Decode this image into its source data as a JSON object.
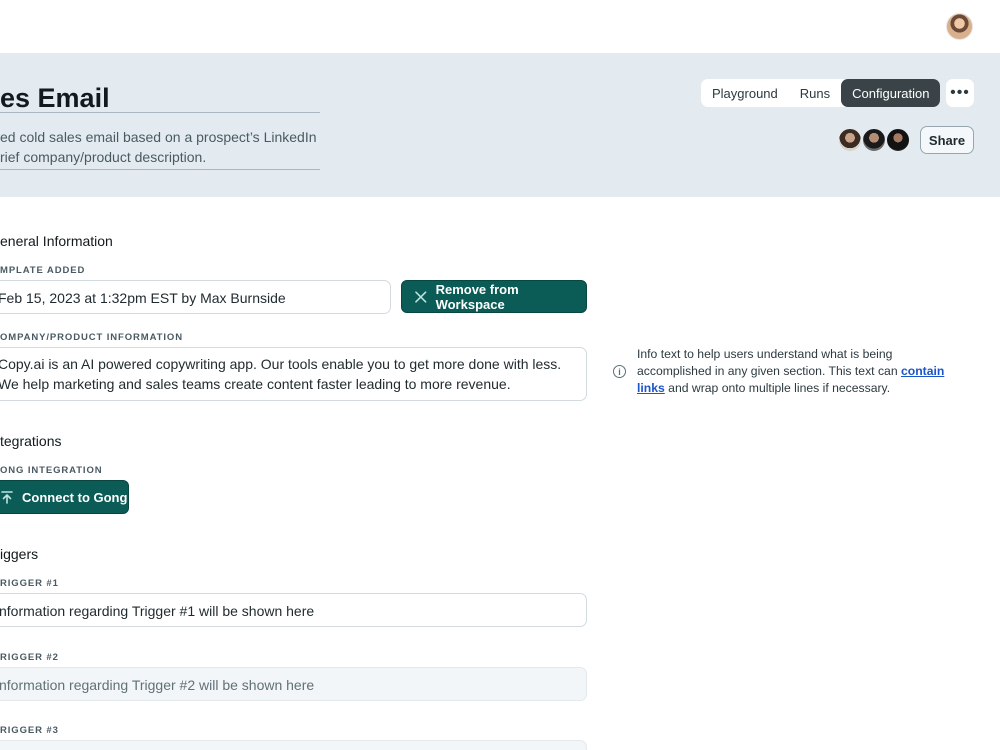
{
  "header": {
    "title": "es Email",
    "description_line1": "ed cold sales email based on a prospect’s LinkedIn",
    "description_line2": "rief company/product description.",
    "tabs": [
      {
        "label": "Playground",
        "active": false
      },
      {
        "label": "Runs",
        "active": false
      },
      {
        "label": "Configuration",
        "active": true
      }
    ],
    "more_label": "•••",
    "share_label": "Share"
  },
  "general": {
    "section_title": "eneral Information",
    "template_added_label": "MPLATE ADDED",
    "template_added_value": "Feb 15, 2023 at 1:32pm EST by Max Burnside",
    "remove_label": "Remove from Workspace",
    "company_label": "OMPANY/PRODUCT INFORMATION",
    "company_line1": "Copy.ai is an AI powered copywriting app. Our tools enable you to get more done with less.",
    "company_line2": "We help marketing and sales teams create content faster leading to more revenue."
  },
  "info": {
    "text_before": "Info text to help users understand what is being accomplished in any given section. This text can ",
    "link_text": "contain links",
    "text_after": " and wrap onto multiple lines if necessary."
  },
  "integrations": {
    "section_title": "tegrations",
    "gong_label": "ONG INTEGRATION",
    "connect_label": "Connect to Gong"
  },
  "triggers": {
    "section_title": "iggers",
    "items": [
      {
        "label": "RIGGER #1",
        "value": "nformation regarding Trigger #1 will be shown here"
      },
      {
        "label": "RIGGER #2",
        "value": "nformation regarding Trigger #2 will be shown here"
      },
      {
        "label": "RIGGER #3",
        "value": ""
      }
    ]
  },
  "colors": {
    "header_bg": "#e3ebf1",
    "primary_teal": "#0b5c56",
    "active_tab": "#3a4347",
    "link": "#1a56c9"
  },
  "icons": {
    "close": "close-icon",
    "upload": "upload-icon",
    "info": "info-icon",
    "more": "more-icon"
  }
}
